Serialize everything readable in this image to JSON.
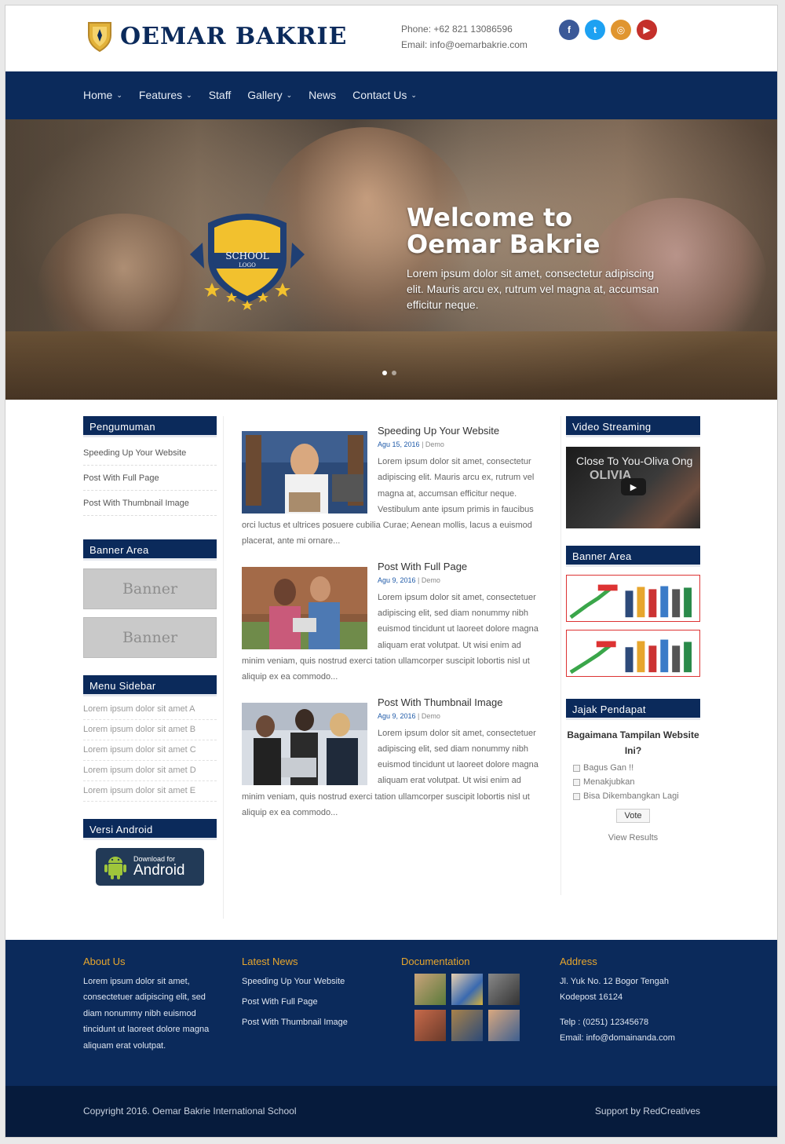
{
  "header": {
    "brand": "OEMAR BAKRIE",
    "phone": "Phone: +62 821 13086596",
    "email": "Email: info@oemarbakrie.com",
    "social": [
      {
        "name": "facebook-icon",
        "glyph": "f",
        "color": "#3b5998"
      },
      {
        "name": "twitter-icon",
        "glyph": "t",
        "color": "#1da1f2"
      },
      {
        "name": "instagram-icon",
        "glyph": "◎",
        "color": "#e0952f"
      },
      {
        "name": "youtube-icon",
        "glyph": "▶",
        "color": "#c4302b"
      }
    ]
  },
  "nav": {
    "items": [
      {
        "label": "Home",
        "dropdown": true
      },
      {
        "label": "Features",
        "dropdown": true
      },
      {
        "label": "Staff",
        "dropdown": false
      },
      {
        "label": "Gallery",
        "dropdown": true
      },
      {
        "label": "News",
        "dropdown": false
      },
      {
        "label": "Contact Us",
        "dropdown": true
      }
    ]
  },
  "hero": {
    "badge_line1": "SCHOOL",
    "badge_line2": "LOGO",
    "title_line1": "Welcome to",
    "title_line2": "Oemar Bakrie",
    "text": "Lorem ipsum dolor sit amet, consectetur adipiscing elit. Mauris arcu ex, rutrum vel magna at, accumsan efficitur neque.",
    "slides": 2,
    "active_slide": 1
  },
  "left_sidebar": {
    "announcements_title": "Pengumuman",
    "announcements": [
      "Speeding Up Your Website",
      "Post With Full Page",
      "Post With Thumbnail Image"
    ],
    "banner_title": "Banner Area",
    "banners": [
      "Banner",
      "Banner"
    ],
    "menu_title": "Menu Sidebar",
    "menu": [
      "Lorem ipsum dolor sit amet A",
      "Lorem ipsum dolor sit amet B",
      "Lorem ipsum dolor sit amet C",
      "Lorem ipsum dolor sit amet D",
      "Lorem ipsum dolor sit amet E"
    ],
    "android_title": "Versi Android",
    "android_small": "Download for",
    "android_big": "Android"
  },
  "posts": [
    {
      "title": "Speeding Up Your Website",
      "date": "Agu 15, 2016",
      "author": "Demo",
      "excerpt": "Lorem ipsum dolor sit amet, consectetur adipiscing elit. Mauris arcu ex, rutrum vel magna at, accumsan efficitur neque. Vestibulum ante ipsum primis in faucibus orci luctus et ultrices posuere cubilia Curae; Aenean mollis, lacus a euismod placerat, ante mi ornare..."
    },
    {
      "title": "Post With Full Page",
      "date": "Agu 9, 2016",
      "author": "Demo",
      "excerpt": "Lorem ipsum dolor sit amet, consectetuer adipiscing elit, sed diam nonummy nibh euismod tincidunt ut laoreet dolore magna aliquam erat volutpat. Ut wisi enim ad minim veniam, quis nostrud exerci tation ullamcorper suscipit lobortis nisl ut aliquip ex ea commodo..."
    },
    {
      "title": "Post With Thumbnail Image",
      "date": "Agu 9, 2016",
      "author": "Demo",
      "excerpt": "Lorem ipsum dolor sit amet, consectetuer adipiscing elit, sed diam nonummy nibh euismod tincidunt ut laoreet dolore magna aliquam erat volutpat. Ut wisi enim ad minim veniam, quis nostrud exerci tation ullamcorper suscipit lobortis nisl ut aliquip ex ea commodo..."
    }
  ],
  "right_sidebar": {
    "video_title": "Video Streaming",
    "video_caption": "Close To You-Oliva Ong",
    "video_overlay": "OLIVIA",
    "banner_title": "Banner Area",
    "poll_title": "Jajak Pendapat",
    "poll_question": "Bagaimana Tampilan Website Ini?",
    "poll_options": [
      "Bagus Gan !!",
      "Menakjubkan",
      "Bisa Dikembangkan Lagi"
    ],
    "vote_label": "Vote",
    "results_label": "View Results"
  },
  "footer": {
    "about_title": "About Us",
    "about_text": "Lorem ipsum dolor sit amet, consectetuer adipiscing elit, sed diam nonummy nibh euismod tincidunt ut laoreet dolore magna aliquam erat volutpat.",
    "news_title": "Latest News",
    "news": [
      "Speeding Up Your Website",
      "Post With Full Page",
      "Post With Thumbnail Image"
    ],
    "doc_title": "Documentation",
    "address_title": "Address",
    "address_line1": "Jl. Yuk No. 12 Bogor Tengah",
    "address_line2": "Kodepost 16124",
    "telp": "Telp : (0251) 12345678",
    "email": "Email: info@domainanda.com"
  },
  "copyright": {
    "left": "Copyright 2016. Oemar Bakrie International School",
    "right": "Support by RedCreatives"
  },
  "colors": {
    "navy": "#0b2a5b",
    "footer_bottom": "#061b3c",
    "accent": "#e7a62d"
  }
}
